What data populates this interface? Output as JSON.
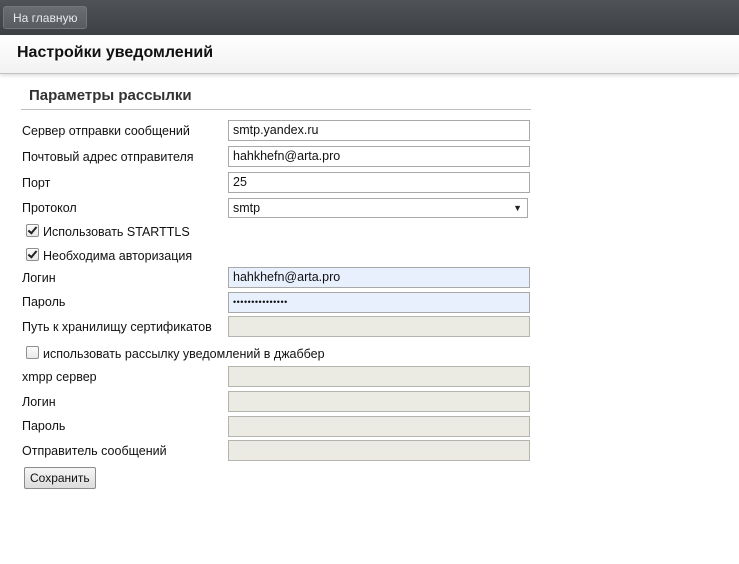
{
  "topbar": {
    "home_label": "На главную"
  },
  "header": {
    "title": "Настройки уведомлений"
  },
  "section": {
    "title": "Параметры рассылки"
  },
  "fields": {
    "smtp_server": {
      "label": "Сервер отправки сообщений",
      "value": "smtp.yandex.ru"
    },
    "sender_email": {
      "label": "Почтовый адрес отправителя",
      "value": "hahkhefn@arta.pro"
    },
    "port": {
      "label": "Порт",
      "value": "25"
    },
    "protocol": {
      "label": "Протокол",
      "value": "smtp"
    },
    "starttls": {
      "label": "Использовать STARTTLS",
      "checked": true
    },
    "auth_required": {
      "label": "Необходима авторизация",
      "checked": true
    },
    "login": {
      "label": "Логин",
      "value": "hahkhefn@arta.pro"
    },
    "password": {
      "label": "Пароль",
      "value": "•••••••••••••••"
    },
    "cert_path": {
      "label": "Путь к хранилищу сертификатов",
      "value": ""
    },
    "use_jabber": {
      "label": "использовать рассылку уведомлений в джаббер",
      "checked": false
    },
    "xmpp_server": {
      "label": "xmpp сервер",
      "value": ""
    },
    "xmpp_login": {
      "label": "Логин",
      "value": ""
    },
    "xmpp_password": {
      "label": "Пароль",
      "value": ""
    },
    "xmpp_sender": {
      "label": "Отправитель сообщений",
      "value": ""
    }
  },
  "actions": {
    "save_label": "Сохранить"
  },
  "colors": {
    "topbar": "#45494d",
    "autofill": "#e8f0fe",
    "disabled": "#ebebe4"
  }
}
